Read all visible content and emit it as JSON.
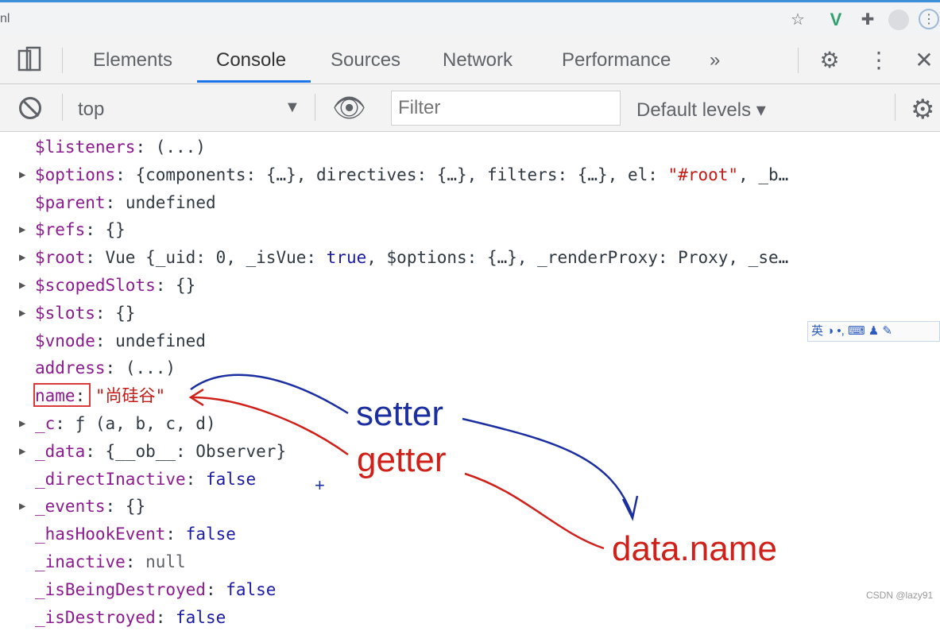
{
  "browser": {
    "url_fragment": "nl",
    "icons": [
      "star-icon",
      "vue-devtools-icon",
      "extensions-icon",
      "profile-icon",
      "menu-icon"
    ]
  },
  "devtools": {
    "tabs": [
      {
        "label": "Elements"
      },
      {
        "label": "Console"
      },
      {
        "label": "Sources"
      },
      {
        "label": "Network"
      },
      {
        "label": "Performance"
      }
    ],
    "more_tabs": "»",
    "active_tab": "Console"
  },
  "toolbar": {
    "context": "top",
    "filter_placeholder": "Filter",
    "levels": "Default levels"
  },
  "console_rows": [
    {
      "expand": false,
      "key": "$listeners",
      "value": "(...)",
      "vclass": "v"
    },
    {
      "expand": true,
      "key": "$options",
      "value": "{components: {…}, directives: {…}, filters: {…}, el: ",
      "str": "\"#root\"",
      "tail": ", _b…"
    },
    {
      "expand": false,
      "key": "$parent",
      "value": "undefined",
      "vclass": "v"
    },
    {
      "expand": true,
      "key": "$refs",
      "value": "{}",
      "vclass": "v"
    },
    {
      "expand": true,
      "key": "$root",
      "value": "Vue {_uid: 0, _isVue: ",
      "bool": "true",
      "tail": ", $options: {…}, _renderProxy: Proxy, _se…"
    },
    {
      "expand": true,
      "key": "$scopedSlots",
      "value": "{}",
      "vclass": "v"
    },
    {
      "expand": true,
      "key": "$slots",
      "value": "{}",
      "vclass": "v"
    },
    {
      "expand": false,
      "key": "$vnode",
      "value": "undefined",
      "vclass": "v"
    },
    {
      "expand": false,
      "key": "address",
      "value": "(...)",
      "vclass": "v"
    },
    {
      "expand": false,
      "key": "name",
      "value": "\"尚硅谷\"",
      "vclass": "str"
    },
    {
      "expand": true,
      "key": "_c",
      "value": "ƒ (a, b, c, d)",
      "vclass": "v"
    },
    {
      "expand": true,
      "key": "_data",
      "value": "{__ob__: Observer}",
      "vclass": "v"
    },
    {
      "expand": false,
      "key": "_directInactive",
      "value": "false",
      "vclass": "bool"
    },
    {
      "expand": true,
      "key": "_events",
      "value": "{}",
      "vclass": "v"
    },
    {
      "expand": false,
      "key": "_hasHookEvent",
      "value": "false",
      "vclass": "bool"
    },
    {
      "expand": false,
      "key": "_inactive",
      "value": "null",
      "vclass": "nul"
    },
    {
      "expand": false,
      "key": "_isBeingDestroyed",
      "value": "false",
      "vclass": "bool"
    },
    {
      "expand": false,
      "key": "_isDestroyed",
      "value": "false",
      "vclass": "bool"
    }
  ],
  "ime_bar": "英 ◑ •, ⌨ ♟ ✎",
  "annotations": {
    "setter": "setter",
    "getter": "getter",
    "target": "data.name",
    "plus": "+"
  },
  "watermark": "CSDN @lazy91",
  "colors": {
    "setter_ink": "#1b2fa0",
    "getter_ink": "#d0201a",
    "active_tab_underline": "#1a73e8"
  }
}
